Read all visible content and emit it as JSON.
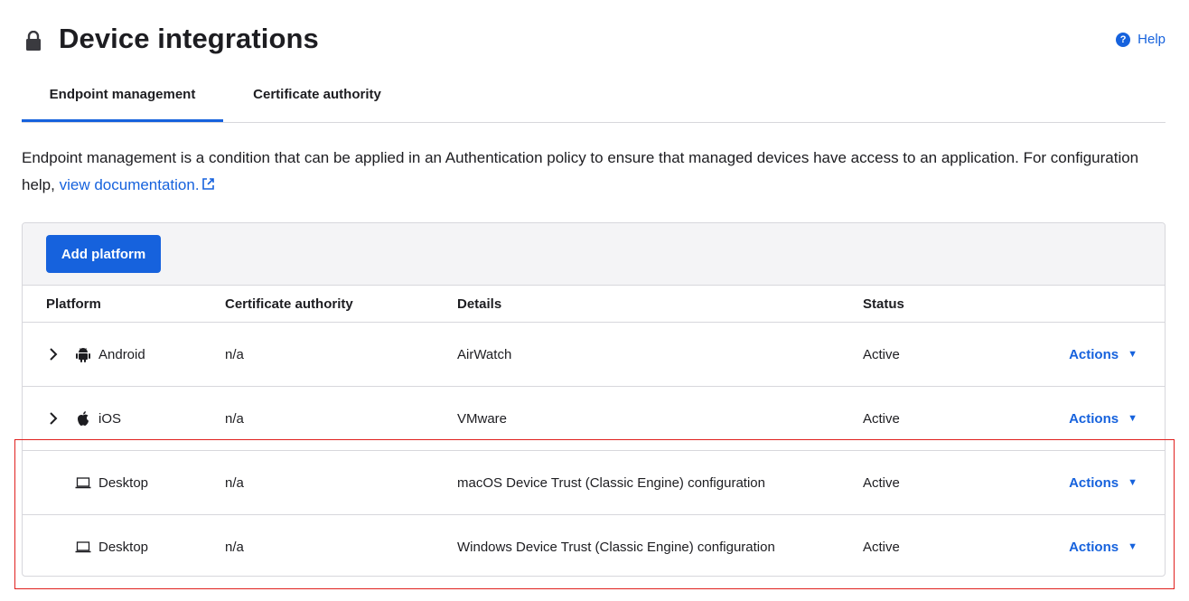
{
  "header": {
    "title": "Device integrations",
    "help_label": "Help",
    "help_icon_glyph": "?"
  },
  "tabs": [
    {
      "label": "Endpoint management",
      "active": true
    },
    {
      "label": "Certificate authority",
      "active": false
    }
  ],
  "description": {
    "text": "Endpoint management is a condition that can be applied in an Authentication policy to ensure that managed devices have access to an application. For configuration help, ",
    "link_label": "view documentation."
  },
  "toolbar": {
    "add_label": "Add platform"
  },
  "table": {
    "columns": [
      "Platform",
      "Certificate authority",
      "Details",
      "Status"
    ],
    "rows": [
      {
        "platform": "Android",
        "icon": "android-icon",
        "expandable": true,
        "ca": "n/a",
        "details": "AirWatch",
        "status": "Active",
        "actions": "Actions"
      },
      {
        "platform": "iOS",
        "icon": "apple-icon",
        "expandable": true,
        "ca": "n/a",
        "details": "VMware",
        "status": "Active",
        "actions": "Actions"
      },
      {
        "platform": "Desktop",
        "icon": "laptop-icon",
        "expandable": false,
        "ca": "n/a",
        "details": "macOS Device Trust (Classic Engine) configuration",
        "status": "Active",
        "actions": "Actions"
      },
      {
        "platform": "Desktop",
        "icon": "laptop-icon",
        "expandable": false,
        "ca": "n/a",
        "details": "Windows Device Trust (Classic Engine) configuration",
        "status": "Active",
        "actions": "Actions"
      }
    ]
  },
  "colors": {
    "accent": "#1662dd",
    "highlight": "#e0201e",
    "toolbar_bg": "#f4f4f6"
  }
}
